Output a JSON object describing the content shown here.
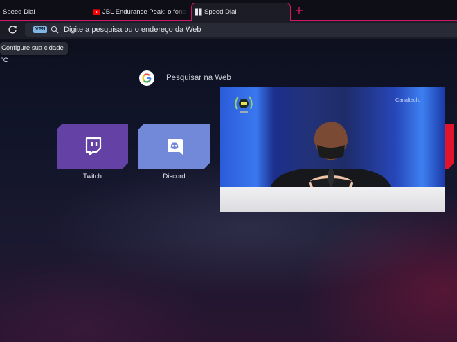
{
  "tabs": [
    {
      "title": "Speed Dial",
      "active": false
    },
    {
      "title": "JBL Endurance Peak: o fone de",
      "active": false,
      "favicon": "youtube-icon"
    },
    {
      "title": "Speed Dial",
      "active": true,
      "favicon": "grid-icon"
    }
  ],
  "address_bar": {
    "vpn_badge": "VPN",
    "placeholder": "Digite a pesquisa ou o endereço da Web"
  },
  "weather": {
    "configure_label": "Configure sua cidade",
    "unit": "°C"
  },
  "web_search": {
    "label": "Pesquisar na Web"
  },
  "speed_dial": [
    {
      "label": "Twitch",
      "icon": "twitch-icon",
      "color": "#6441a5"
    },
    {
      "label": "Discord",
      "icon": "discord-icon",
      "color": "#7289da"
    }
  ],
  "video": {
    "watermark": "Canaltech."
  },
  "colors": {
    "accent": "#d0186a",
    "tab_bg": "#0e0f16",
    "toolbar_bg": "#1b1c26"
  }
}
